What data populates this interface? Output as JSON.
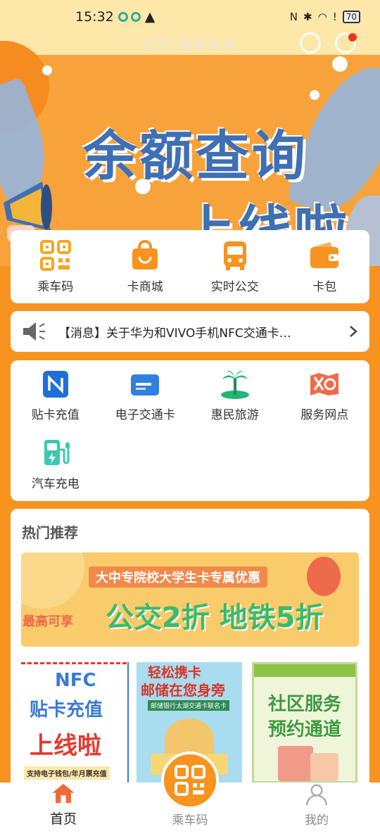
{
  "status": {
    "time": "15:32",
    "battery": "70"
  },
  "header": {
    "slogan": "汇行 智享未来"
  },
  "hero": {
    "title_line1": "余额查询",
    "title_line2": "上线啦"
  },
  "quick_actions": [
    {
      "label": "乘车码",
      "icon": "qr-code-icon"
    },
    {
      "label": "卡商城",
      "icon": "shopping-bag-icon"
    },
    {
      "label": "实时公交",
      "icon": "bus-icon"
    },
    {
      "label": "卡包",
      "icon": "wallet-icon"
    }
  ],
  "notice": {
    "text": "【消息】关于华为和VIVO手机NFC交通卡…"
  },
  "services": [
    {
      "label": "贴卡充值",
      "icon": "nfc-icon"
    },
    {
      "label": "电子交通卡",
      "icon": "card-icon"
    },
    {
      "label": "惠民旅游",
      "icon": "palm-tree-icon"
    },
    {
      "label": "服务网点",
      "icon": "map-location-icon"
    },
    {
      "label": "汽车充电",
      "icon": "ev-charger-icon"
    }
  ],
  "recommend": {
    "title": "热门推荐",
    "banner": {
      "headline": "大中专院校大学生卡专属优惠",
      "prefix": "最高可享",
      "offer": "公交2折 地铁5折"
    },
    "promos": [
      {
        "lines": [
          "NFC",
          "贴卡充值",
          "上线啦"
        ],
        "footer": "支持电子钱包/年月票充值"
      },
      {
        "lines": [
          "轻松携卡",
          "邮储在您身旁"
        ],
        "footer": "邮储银行太湖交通卡联名卡"
      },
      {
        "lines": [
          "社区服务",
          "预约通道"
        ]
      }
    ]
  },
  "tabbar": [
    {
      "label": "首页",
      "icon": "home-icon"
    },
    {
      "label": "乘车码",
      "icon": "qr-code-icon"
    },
    {
      "label": "我的",
      "icon": "user-icon"
    }
  ],
  "colors": {
    "brand": "#f7931e",
    "hero_blue": "#3f6fb5"
  }
}
